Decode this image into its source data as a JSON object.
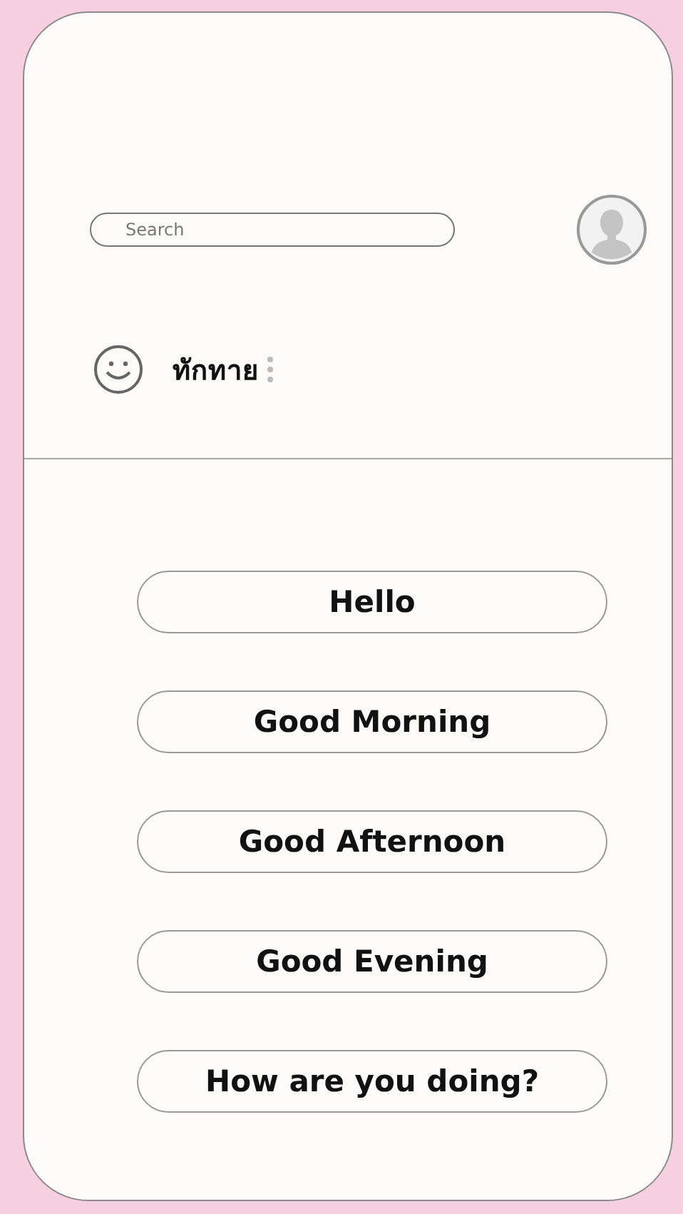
{
  "search": {
    "placeholder": "Search"
  },
  "menu": {
    "label": "ทักทาย"
  },
  "phrases": [
    {
      "label": "Hello"
    },
    {
      "label": "Good Morning"
    },
    {
      "label": "Good Afternoon"
    },
    {
      "label": "Good Evening"
    },
    {
      "label": "How are you doing?"
    }
  ]
}
